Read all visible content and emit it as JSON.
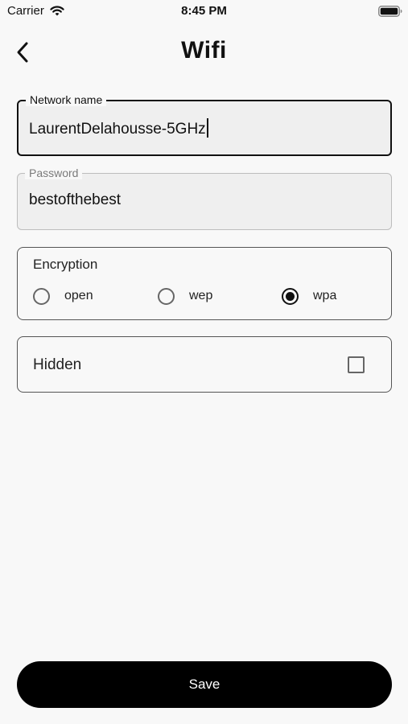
{
  "status_bar": {
    "carrier": "Carrier",
    "time": "8:45 PM",
    "wifi_icon": "wifi-signal-icon",
    "battery_icon": "battery-icon"
  },
  "header": {
    "title": "Wifi",
    "back_icon": "chevron-left-icon"
  },
  "form": {
    "network_name": {
      "label": "Network name",
      "value": "LaurentDelahousse-5GHz",
      "focused": true
    },
    "password": {
      "label": "Password",
      "value": "bestofthebest"
    },
    "encryption": {
      "title": "Encryption",
      "options": [
        "open",
        "wep",
        "wpa"
      ],
      "selected": "wpa"
    },
    "hidden": {
      "label": "Hidden",
      "checked": false
    }
  },
  "actions": {
    "save_label": "Save"
  },
  "colors": {
    "background": "#f8f8f8",
    "field_fill": "#efefef",
    "primary": "#000000",
    "on_primary": "#ffffff"
  }
}
